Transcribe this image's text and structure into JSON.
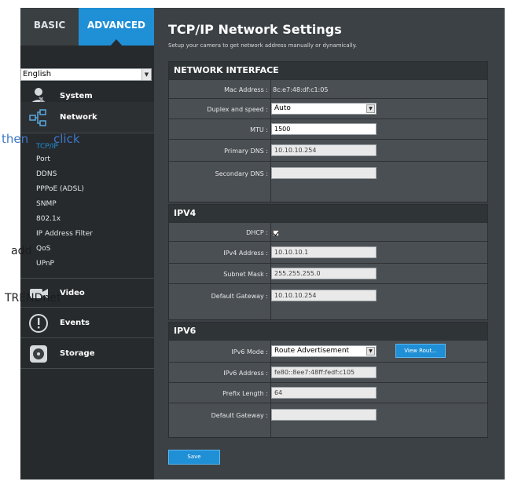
{
  "tabs": {
    "basic": "BASIC",
    "advanced": "ADVANCED"
  },
  "language": {
    "selected": "English"
  },
  "menu": {
    "system": "System",
    "network": "Network",
    "video": "Video",
    "events": "Events",
    "storage": "Storage"
  },
  "submenu": [
    "TCP/IP",
    "Port",
    "DDNS",
    "PPPoE (ADSL)",
    "SNMP",
    "802.1x",
    "IP Address Filter",
    "QoS",
    "UPnP"
  ],
  "annotations": {
    "then": "then",
    "click": "click",
    "add": "add",
    "trendnet": "TRENDnet"
  },
  "page": {
    "title": "TCP/IP Network Settings",
    "subtitle": "Setup your camera to get network address manually or dynamically."
  },
  "network_interface": {
    "heading": "NETWORK INTERFACE",
    "mac_label": "Mac Address :",
    "mac_value": "8c:e7:48:df:c1:05",
    "duplex_label": "Duplex and speed :",
    "duplex_value": "Auto",
    "mtu_label": "MTU :",
    "mtu_value": "1500",
    "primary_dns_label": "Primary DNS :",
    "primary_dns_value": "10.10.10.254",
    "secondary_dns_label": "Secondary DNS :",
    "secondary_dns_value": ""
  },
  "ipv4": {
    "heading": "IPV4",
    "dhcp_label": "DHCP :",
    "dhcp_checked": true,
    "address_label": "IPv4 Address :",
    "address_value": "10.10.10.1",
    "subnet_label": "Subnet Mask :",
    "subnet_value": "255.255.255.0",
    "gateway_label": "Default Gateway :",
    "gateway_value": "10.10.10.254"
  },
  "ipv6": {
    "heading": "IPV6",
    "mode_label": "IPv6 Mode :",
    "mode_value": "Route Advertisement",
    "view_route_button": "View Rout...",
    "address_label": "IPv6 Address :",
    "address_value": "fe80::8ee7:48ff:fedf:c105",
    "prefix_label": "Prefix Length :",
    "prefix_value": "64",
    "gateway_label": "Default Gateway :",
    "gateway_value": ""
  },
  "save_button": "Save",
  "colors": {
    "accent": "#1f8fd6",
    "sidebar": "#262a2d",
    "panel": "#3c4145",
    "section": "#4a4f53"
  }
}
